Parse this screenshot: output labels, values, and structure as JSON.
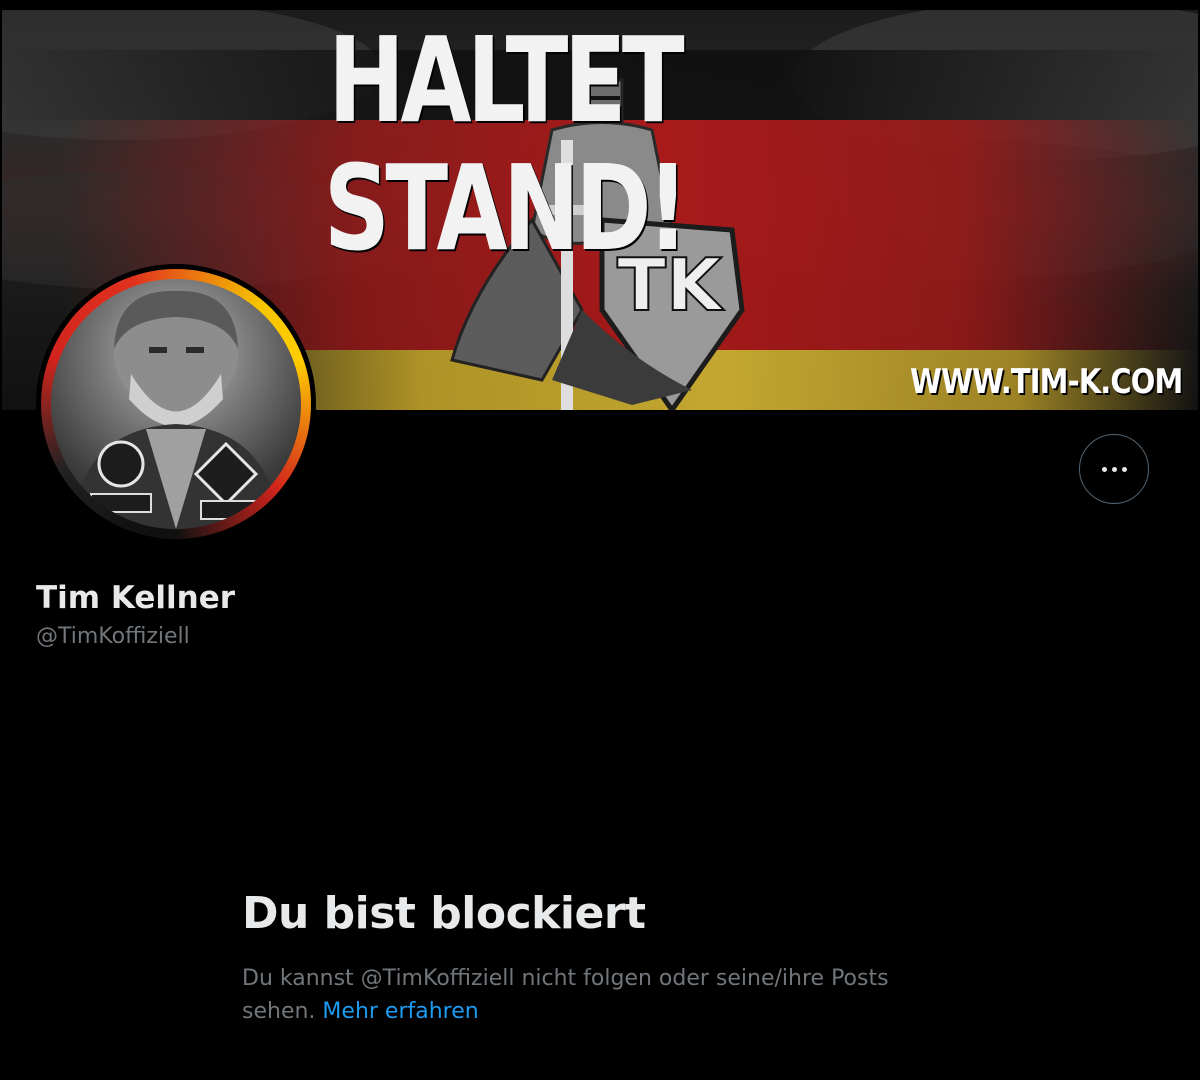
{
  "banner": {
    "title": "HALTET STAND!",
    "url": "WWW.TIM-K.COM",
    "flag_colors": [
      "#000000",
      "#dd0000",
      "#ffce00"
    ]
  },
  "profile": {
    "display_name": "Tim Kellner",
    "handle": "@TimKoffiziell",
    "more_icon": "ellipsis-icon"
  },
  "blocked": {
    "title": "Du bist blockiert",
    "message": "Du kannst @TimKoffiziell nicht folgen oder seine/ihre Posts sehen.",
    "learn_more": "Mehr erfahren"
  },
  "colors": {
    "background": "#000000",
    "primary_text": "#e7e9ea",
    "secondary_text": "#71767b",
    "link": "#1d9bf0"
  }
}
